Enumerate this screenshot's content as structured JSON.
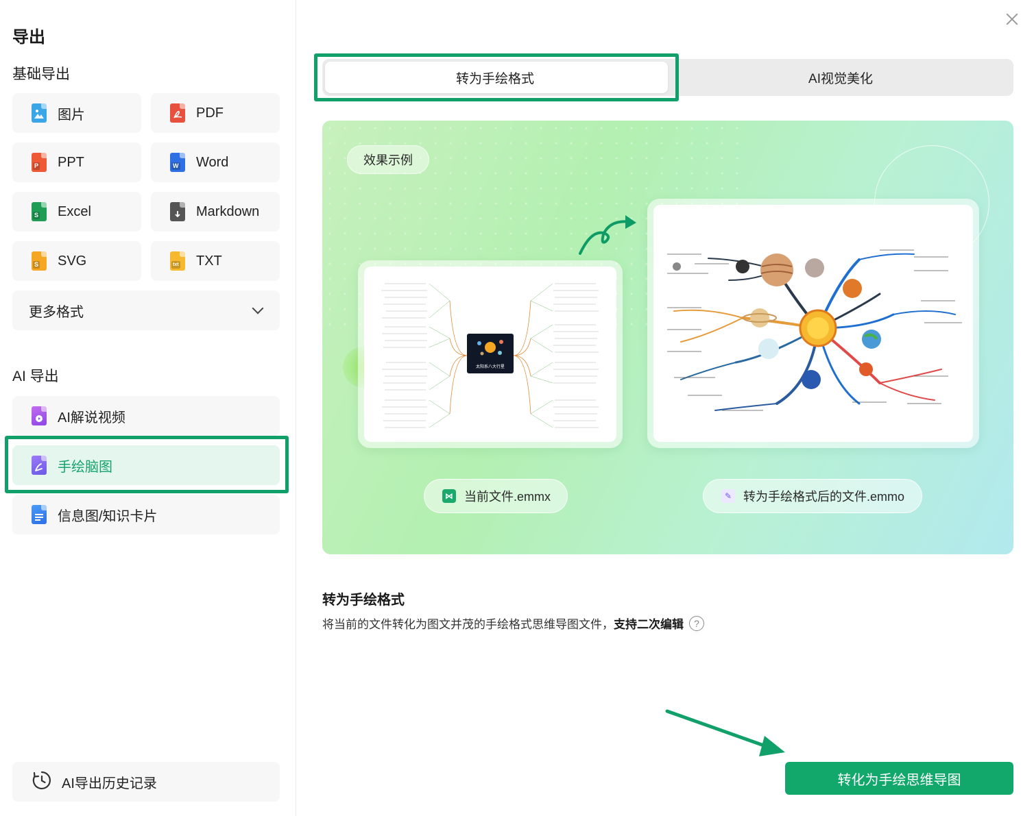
{
  "sidebar": {
    "title": "导出",
    "basic_section": "基础导出",
    "basic_formats": [
      {
        "label": "图片",
        "icon": "image-file-icon",
        "color": "#3aa6e8"
      },
      {
        "label": "PDF",
        "icon": "pdf-file-icon",
        "color": "#e8503e"
      },
      {
        "label": "PPT",
        "icon": "ppt-file-icon",
        "color": "#ee5a36"
      },
      {
        "label": "Word",
        "icon": "word-file-icon",
        "color": "#2f6fe4"
      },
      {
        "label": "Excel",
        "icon": "excel-file-icon",
        "color": "#1f9d55"
      },
      {
        "label": "Markdown",
        "icon": "markdown-file-icon",
        "color": "#555555"
      },
      {
        "label": "SVG",
        "icon": "svg-file-icon",
        "color": "#f5a623"
      },
      {
        "label": "TXT",
        "icon": "txt-file-icon",
        "color": "#f5b82e"
      }
    ],
    "more_formats": "更多格式",
    "ai_section": "AI 导出",
    "ai_items": [
      {
        "label": "AI解说视频",
        "icon": "ai-video-icon"
      },
      {
        "label": "手绘脑图",
        "icon": "hand-drawn-mindmap-icon"
      },
      {
        "label": "信息图/知识卡片",
        "icon": "infographic-icon"
      }
    ],
    "history": "AI导出历史记录"
  },
  "tabs": {
    "hand_drawn": "转为手绘格式",
    "ai_visual": "AI视觉美化"
  },
  "preview": {
    "badge": "效果示例",
    "current_file": "当前文件.emmx",
    "converted_file": "转为手绘格式后的文件.emmo",
    "mindmap_center": "太阳系八大行星"
  },
  "description": {
    "title": "转为手绘格式",
    "text": "将当前的文件转化为图文并茂的手绘格式思维导图文件，",
    "bold": "支持二次编辑",
    "help": "?"
  },
  "convert_button": "转化为手绘思维导图",
  "colors": {
    "accent": "#12a86c",
    "highlight_border": "#12a06a"
  }
}
